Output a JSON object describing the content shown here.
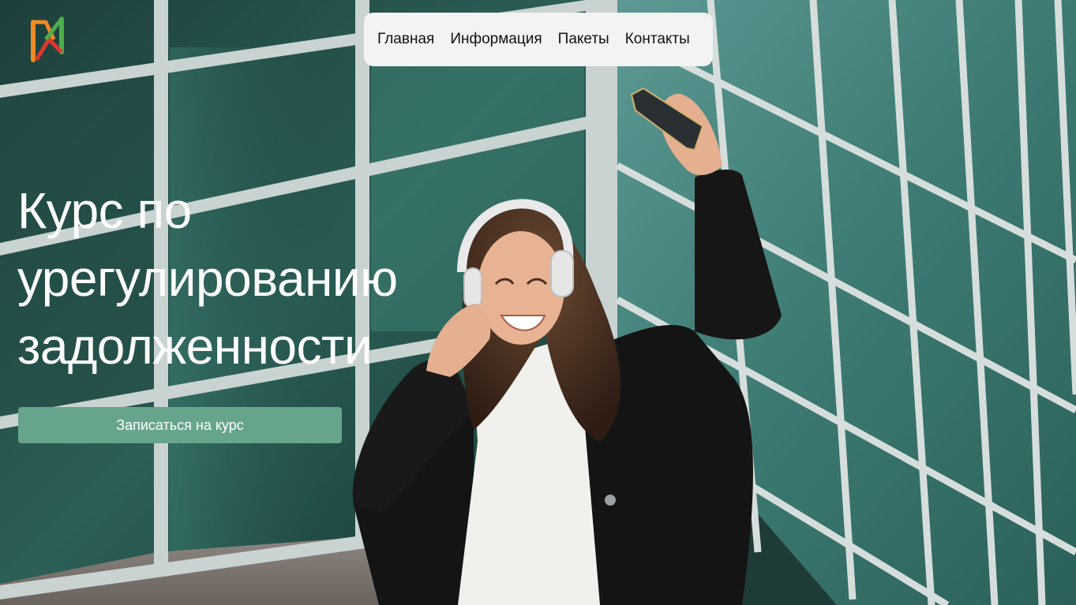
{
  "nav": {
    "items": [
      {
        "label": "Главная"
      },
      {
        "label": "Информация"
      },
      {
        "label": "Пакеты"
      },
      {
        "label": "Контакты"
      }
    ]
  },
  "hero": {
    "title_lines": [
      "Курс по",
      "урегулированию",
      "задолженности"
    ],
    "cta_label": "Записаться на курс"
  },
  "icons": {
    "logo": "brand-logo-icon"
  },
  "colors": {
    "accent": "#66a58c",
    "nav_bg": "#f3f3f3",
    "nav_text": "#111111",
    "title_text": "#ffffff",
    "logo_orange": "#f08a24",
    "logo_green": "#4cae4c",
    "logo_red": "#e0362c",
    "glass": "#2e6b60",
    "frame": "#c9d3d2"
  }
}
